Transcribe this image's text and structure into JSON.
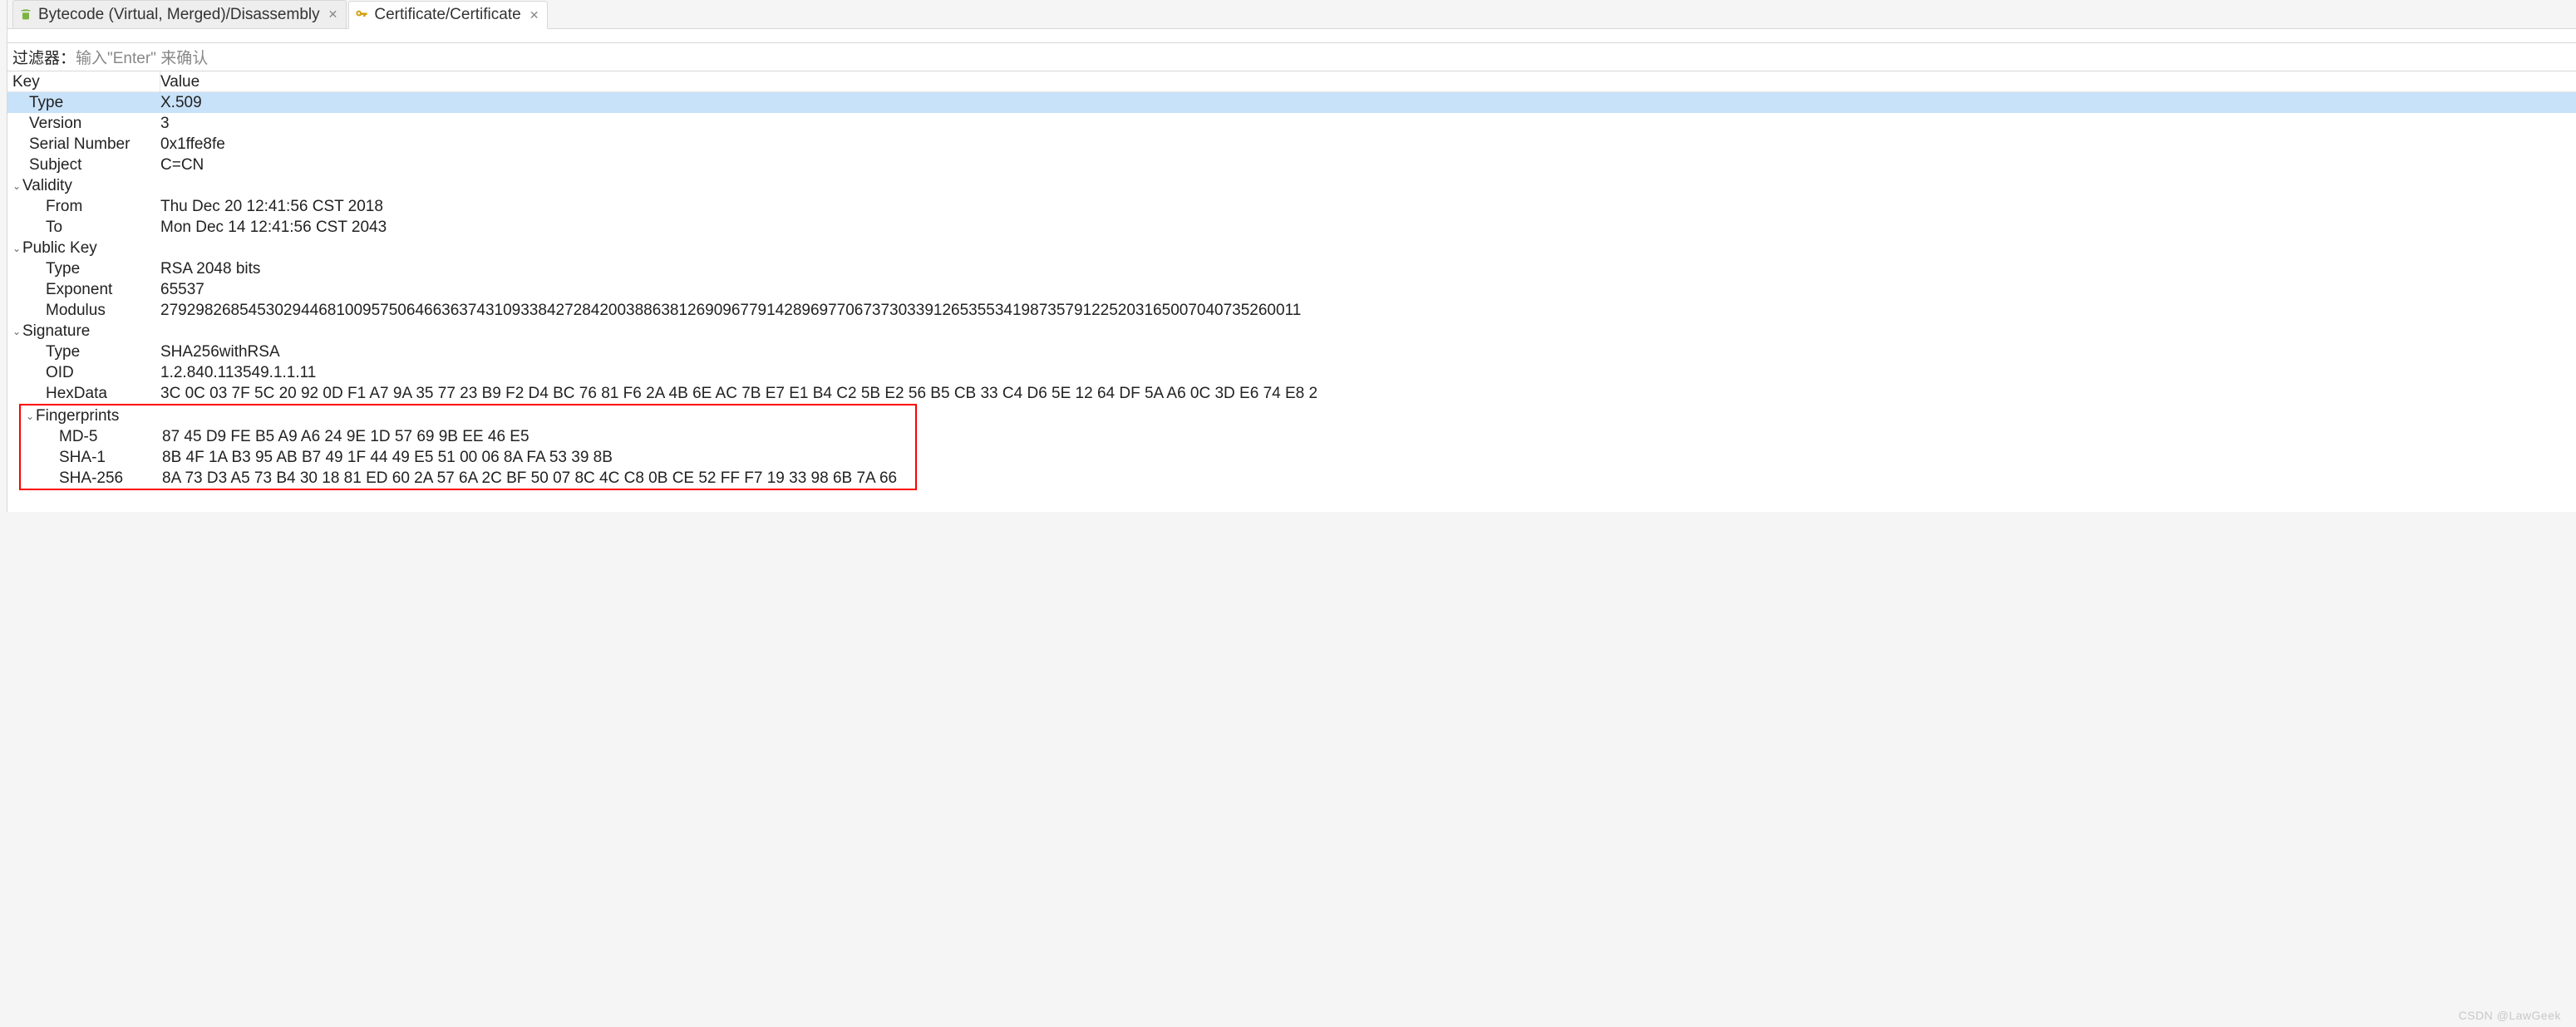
{
  "tabs": {
    "bytecode": {
      "label": "Bytecode (Virtual, Merged)/Disassembly"
    },
    "certificate": {
      "label": "Certificate/Certificate"
    }
  },
  "filter": {
    "label": "过滤器：",
    "placeholder": "输入\"Enter\" 来确认"
  },
  "columns": {
    "key": "Key",
    "value": "Value"
  },
  "cert": {
    "type": {
      "k": "Type",
      "v": "X.509"
    },
    "version": {
      "k": "Version",
      "v": "3"
    },
    "serial": {
      "k": "Serial Number",
      "v": "0x1ffe8fe"
    },
    "subject": {
      "k": "Subject",
      "v": "C=CN"
    },
    "validity": {
      "k": "Validity"
    },
    "valid_from": {
      "k": "From",
      "v": "Thu Dec 20 12:41:56 CST 2018"
    },
    "valid_to": {
      "k": "To",
      "v": "Mon Dec 14 12:41:56 CST 2043"
    },
    "pubkey": {
      "k": "Public Key"
    },
    "pk_type": {
      "k": "Type",
      "v": "RSA 2048 bits"
    },
    "pk_exp": {
      "k": "Exponent",
      "v": "65537"
    },
    "pk_mod": {
      "k": "Modulus",
      "v": "2792982685453029446810095750646636374310933842728420038863812690967791428969770673730339126535534198735791225203165007040735260011"
    },
    "sig": {
      "k": "Signature"
    },
    "sig_type": {
      "k": "Type",
      "v": "SHA256withRSA"
    },
    "sig_oid": {
      "k": "OID",
      "v": "1.2.840.113549.1.1.11"
    },
    "sig_hex": {
      "k": "HexData",
      "v": "3C 0C 03 7F 5C 20 92 0D F1 A7 9A 35 77 23 B9 F2 D4 BC 76 81 F6 2A 4B 6E AC 7B E7 E1 B4 C2 5B E2 56 B5 CB 33 C4 D6 5E 12 64 DF 5A A6 0C 3D E6 74 E8 2"
    },
    "fp": {
      "k": "Fingerprints"
    },
    "fp_md5": {
      "k": "MD-5",
      "v": "87 45 D9 FE B5 A9 A6 24 9E 1D 57 69 9B EE 46 E5"
    },
    "fp_sha1": {
      "k": "SHA-1",
      "v": "8B 4F 1A B3 95 AB B7 49 1F 44 49 E5 51 00 06 8A FA 53 39 8B"
    },
    "fp_sha256": {
      "k": "SHA-256",
      "v": "8A 73 D3 A5 73 B4 30 18 81 ED 60 2A 57 6A 2C BF 50 07 8C 4C C8 0B CE 52 FF F7 19 33 98 6B 7A 66"
    }
  },
  "watermark": "CSDN @LawGeek"
}
